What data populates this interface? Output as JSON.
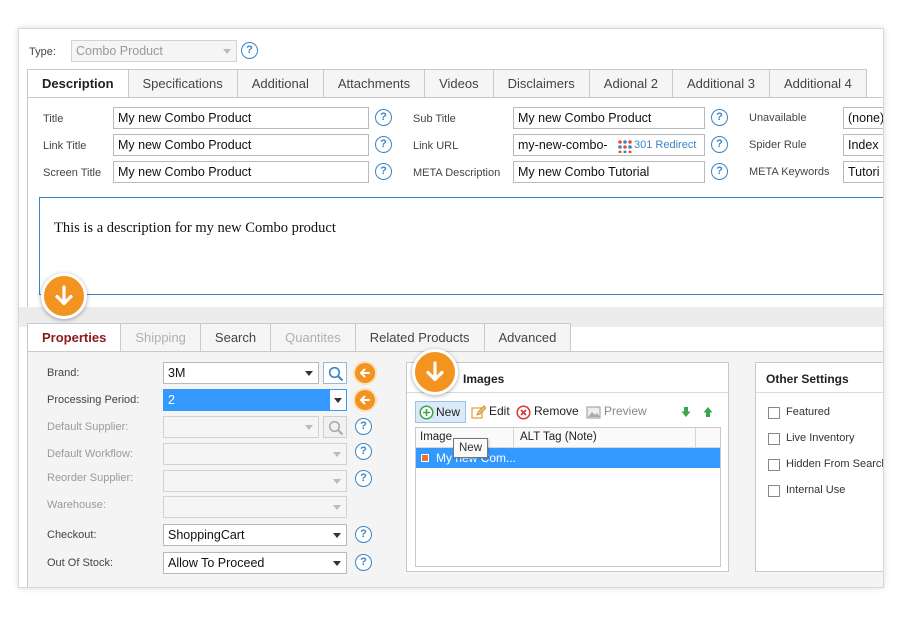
{
  "type_field": {
    "label": "Type:",
    "value": "Combo Product"
  },
  "top_tabs": [
    "Description",
    "Specifications",
    "Additional",
    "Attachments",
    "Videos",
    "Disclaimers",
    "Adional 2",
    "Additional 3",
    "Additional 4"
  ],
  "description_form": {
    "title_label": "Title",
    "title_value": "My new Combo Product",
    "link_title_label": "Link Title",
    "link_title_value": "My new Combo Product",
    "screen_title_label": "Screen Title",
    "screen_title_value": "My new Combo Product",
    "sub_title_label": "Sub Title",
    "sub_title_value": "My new Combo Product",
    "link_url_label": "Link URL",
    "link_url_value": "my-new-combo-",
    "redirect_label": "301 Redirect",
    "meta_description_label": "META Description",
    "meta_description_value": "My new Combo Tutorial",
    "unavailable_label": "Unavailable",
    "unavailable_value": "(none)",
    "spider_rule_label": "Spider Rule",
    "spider_rule_value": "Index",
    "meta_keywords_label": "META Keywords",
    "meta_keywords_value": "Tutori"
  },
  "description_text": "This is a description for my new Combo product",
  "bottom_tabs": [
    "Properties",
    "Shipping",
    "Search",
    "Quantites",
    "Related Products",
    "Advanced"
  ],
  "properties": {
    "brand_label": "Brand:",
    "brand_value": "3M",
    "processing_period_label": "Processing Period:",
    "processing_period_value": "2",
    "default_supplier_label": "Default Supplier:",
    "default_workflow_label": "Default Workflow:",
    "reorder_supplier_label": "Reorder Supplier:",
    "warehouse_label": "Warehouse:",
    "checkout_label": "Checkout:",
    "checkout_value": "ShoppingCart",
    "out_of_stock_label": "Out Of Stock:",
    "out_of_stock_value": "Allow To Proceed"
  },
  "images_panel": {
    "title": "Images",
    "toolbar": {
      "new": "New",
      "edit": "Edit",
      "remove": "Remove",
      "preview": "Preview"
    },
    "columns": [
      "Image",
      "ALT Tag (Note)"
    ],
    "rows": [
      {
        "image": "My new Com..."
      }
    ],
    "tooltip": "New"
  },
  "other_settings": {
    "title": "Other Settings",
    "options": [
      "Featured",
      "Live Inventory",
      "Hidden From Search",
      "Internal Use"
    ]
  },
  "colors": {
    "accent_orange": "#f39320",
    "selection_blue": "#3399ff",
    "help_blue": "#3b84c4",
    "active_tab_red": "#8b1a1a"
  },
  "icons": {
    "help": "question-circle-icon",
    "down_callout": "arrow-down-circle-icon",
    "left_callout": "arrow-left-circle-icon",
    "search": "magnifier-icon",
    "new": "plus-circle-icon",
    "edit": "pencil-icon",
    "remove": "x-circle-icon",
    "preview": "picture-icon",
    "move_down": "green-arrow-down-icon",
    "move_up": "green-arrow-up-icon"
  }
}
